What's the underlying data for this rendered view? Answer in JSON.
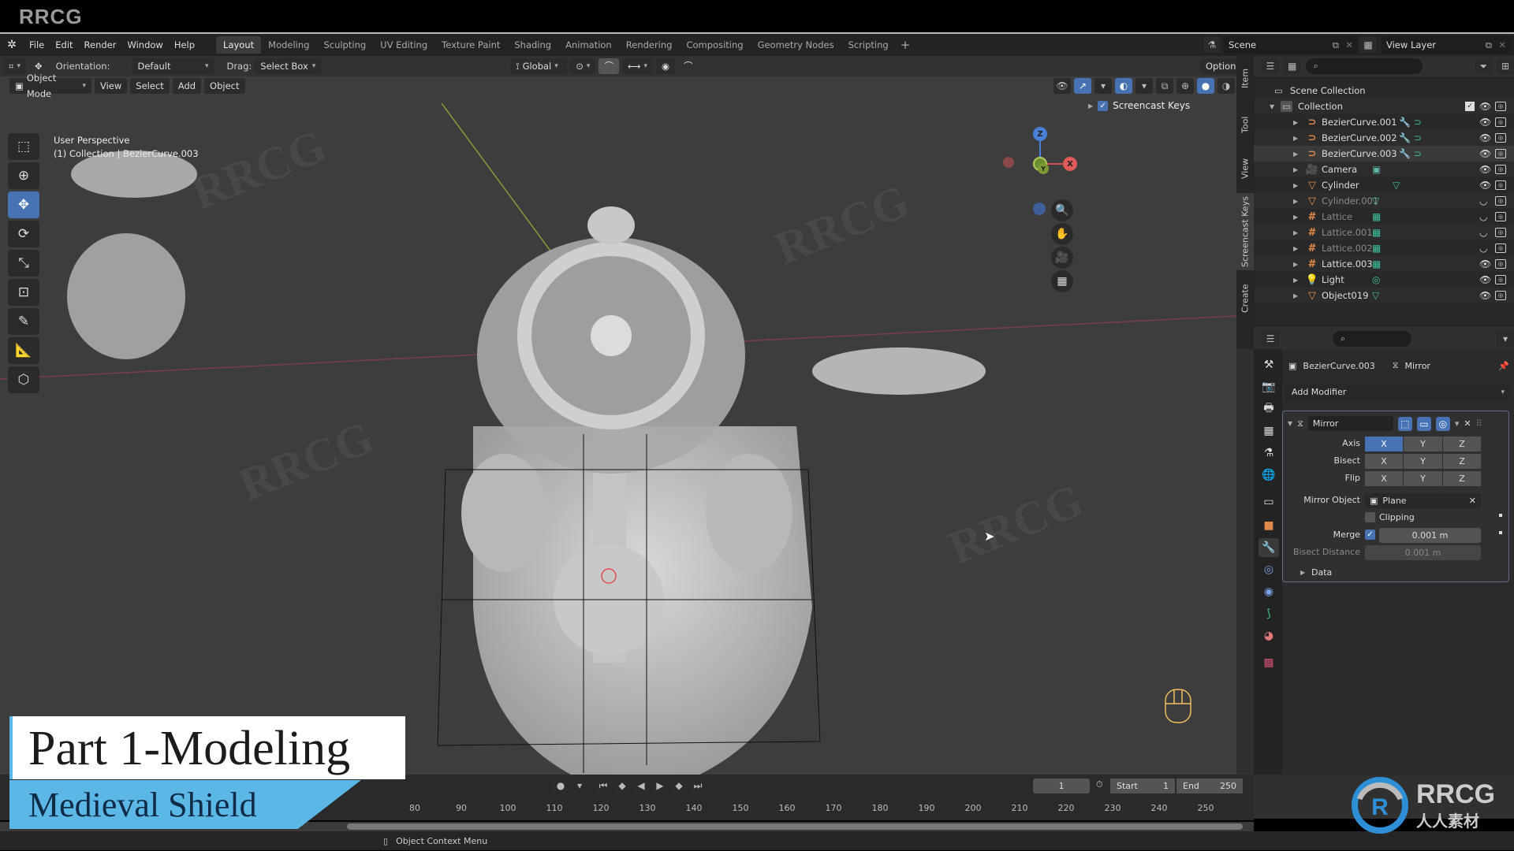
{
  "brand": {
    "top_left": "RRCG",
    "logo_text": "RRCG",
    "logo_sub": "人人素材"
  },
  "menubar": {
    "menus": [
      "File",
      "Edit",
      "Render",
      "Window",
      "Help"
    ],
    "workspaces": [
      "Layout",
      "Modeling",
      "Sculpting",
      "UV Editing",
      "Texture Paint",
      "Shading",
      "Animation",
      "Rendering",
      "Compositing",
      "Geometry Nodes",
      "Scripting"
    ],
    "active_workspace": "Layout",
    "add_workspace": "+",
    "scene": "Scene",
    "view_layer": "View Layer"
  },
  "viewport_header": {
    "orientation_label": "Orientation:",
    "orientation_value": "Default",
    "drag_label": "Drag:",
    "drag_value": "Select Box",
    "transform_orientation": "Global",
    "options": "Options",
    "mode": "Object Mode",
    "menus": [
      "View",
      "Select",
      "Add",
      "Object"
    ]
  },
  "viewport": {
    "perspective": "User Perspective",
    "context": "(1) Collection | BezierCurve.003",
    "screencast_keys": "Screencast Keys",
    "gizmo": {
      "z": "Z",
      "x": "X",
      "y": "Y"
    }
  },
  "npanel_tabs": [
    "Item",
    "Tool",
    "View",
    "Screencast Keys",
    "Create"
  ],
  "npanel_active": "Screencast Keys",
  "outliner": {
    "root": "Scene Collection",
    "collection": "Collection",
    "items": [
      {
        "name": "BezierCurve.001",
        "type": "curve",
        "visible": true
      },
      {
        "name": "BezierCurve.002",
        "type": "curve",
        "visible": true
      },
      {
        "name": "BezierCurve.003",
        "type": "curve",
        "visible": true,
        "selected": true
      },
      {
        "name": "Camera",
        "type": "camera",
        "visible": true
      },
      {
        "name": "Cylinder",
        "type": "mesh",
        "visible": true
      },
      {
        "name": "Cylinder.001",
        "type": "mesh",
        "visible": false
      },
      {
        "name": "Lattice",
        "type": "lattice",
        "visible": false
      },
      {
        "name": "Lattice.001",
        "type": "lattice",
        "visible": false
      },
      {
        "name": "Lattice.002",
        "type": "lattice",
        "visible": false
      },
      {
        "name": "Lattice.003",
        "type": "lattice",
        "visible": true
      },
      {
        "name": "Light",
        "type": "light",
        "visible": true
      },
      {
        "name": "Object019",
        "type": "mesh",
        "visible": true
      }
    ]
  },
  "properties": {
    "object": "BezierCurve.003",
    "modifier_crumb": "Mirror",
    "add_modifier": "Add Modifier",
    "modifier": {
      "name": "Mirror",
      "axis_label": "Axis",
      "bisect_label": "Bisect",
      "flip_label": "Flip",
      "axes": [
        "X",
        "Y",
        "Z"
      ],
      "axis_active": "X",
      "mirror_object_label": "Mirror Object",
      "mirror_object": "Plane",
      "clipping_label": "Clipping",
      "clipping": false,
      "merge_label": "Merge",
      "merge": true,
      "merge_value": "0.001 m",
      "bisect_distance_label": "Bisect Distance",
      "bisect_distance": "0.001 m",
      "data_label": "Data"
    }
  },
  "timeline": {
    "current_frame": "1",
    "start_label": "Start",
    "start": "1",
    "end_label": "End",
    "end": "250",
    "ticks": [
      "80",
      "90",
      "100",
      "110",
      "120",
      "130",
      "140",
      "150",
      "160",
      "170",
      "180",
      "190",
      "200",
      "210",
      "220",
      "230",
      "240",
      "250"
    ]
  },
  "statusbar": {
    "hint": "Object Context Menu"
  },
  "overlay": {
    "title": "Part 1-Modeling",
    "subtitle": "Medieval Shield",
    "accent": "#5ab7e6"
  }
}
